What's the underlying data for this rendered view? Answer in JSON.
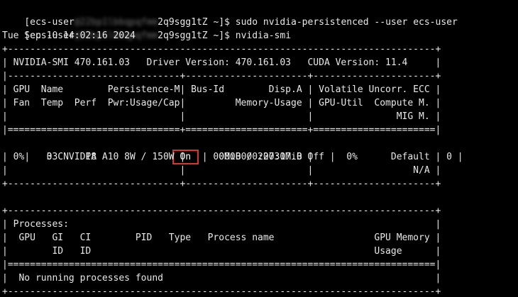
{
  "theme": {
    "background": "#000000",
    "foreground": "#e8e8e8",
    "highlight_border": "#d7372b",
    "redacted_text": "#6f6f6f"
  },
  "terminal": {
    "cmd1": {
      "prompt_start": "[ecs-user",
      "redacted": "@22bp1lbbqpqfmm",
      "prompt_end": "2q9sgg1tZ ~]$ ",
      "command": "sudo nvidia-persistenced --user ecs-user"
    },
    "cmd2": {
      "prompt_start": "[ecs-user",
      "redacted": "@22bp1lbbqpqfmm",
      "prompt_end": "2q9sgg1tZ ~]$ ",
      "command": "nvidia-smi"
    },
    "timestamp": "Tue Sep 10 14:02:16 2024",
    "border_top": "+-----------------------------------------------------------------------------+",
    "smi_version_line": "| NVIDIA-SMI 470.161.03   Driver Version: 470.161.03   CUDA Version: 11.4     |",
    "border_sep": "|-------------------------------+----------------------+----------------------+",
    "header_row1": "| GPU  Name        Persistence-M| Bus-Id        Disp.A | Volatile Uncorr. ECC |",
    "header_row2": "| Fan  Temp  Perf  Pwr:Usage/Cap|         Memory-Usage | GPU-Util  Compute M. |",
    "header_row3": "|                               |                      |               MIG M. |",
    "border_double": "|===============================+======================+======================|",
    "gpu_row1": {
      "before": "|   0  NVIDIA A10          ",
      "persistence": " On ",
      "after": " | 00000000:00:07.0 Off |                    0 |"
    },
    "gpu_row2": "| 0%    33C    P8     8W / 150W |      0MiB / 22731MiB |      0%      Default |",
    "gpu_row3": "|                               |                      |                  N/A |",
    "border_section_end": "+-------------------------------+----------------------+----------------------+",
    "blank": " ",
    "proc_border_top": "+-----------------------------------------------------------------------------+",
    "proc_title": "| Processes:                                                                  |",
    "proc_header1": "|  GPU   GI   CI        PID   Type   Process name                  GPU Memory |",
    "proc_header2": "|        ID   ID                                                   Usage      |",
    "proc_border_double": "|=============================================================================|",
    "proc_empty": "|  No running processes found                                                 |",
    "proc_border_bottom": "+-----------------------------------------------------------------------------+"
  }
}
